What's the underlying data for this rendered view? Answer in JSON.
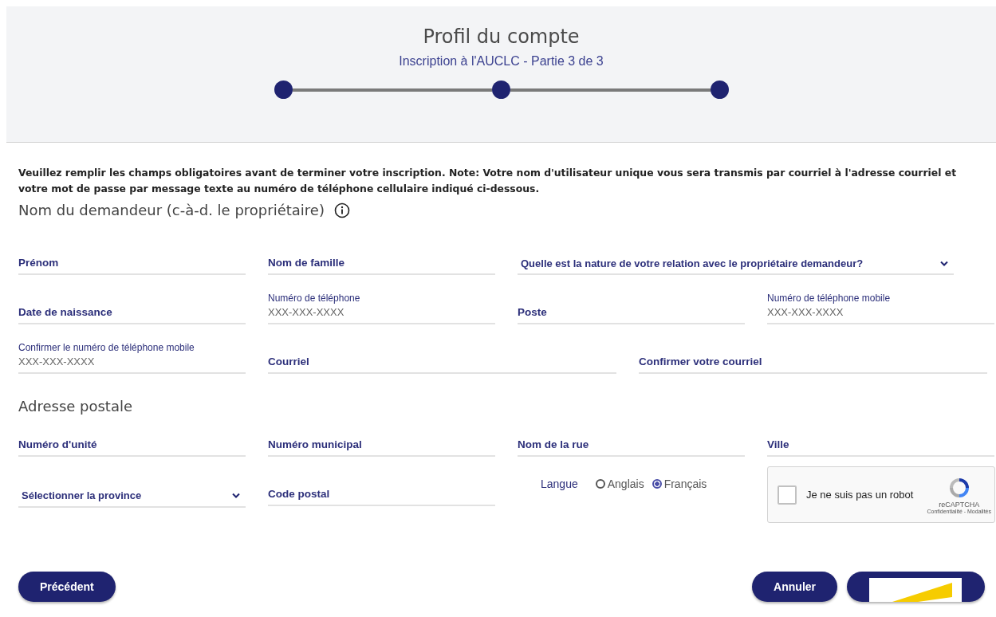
{
  "header": {
    "title": "Profil du compte",
    "subtitle": "Inscription à l'AUCLC - Partie 3 de 3",
    "steps": [
      {
        "completed": true
      },
      {
        "completed": true
      },
      {
        "completed": true
      }
    ]
  },
  "note": "Veuillez remplir les champs obligatoires avant de terminer votre inscription.   Note: Votre nom d'utilisateur unique vous sera transmis par courriel à l'adresse courriel et votre mot de passe par message texte au numéro de téléphone cellulaire indiqué ci-dessous.",
  "sections": [
    {
      "heading": "Nom du demandeur (c-à-d. le propriétaire)",
      "info": true,
      "rows": [
        [
          {
            "kind": "text",
            "label": "Prénom"
          },
          {
            "kind": "text",
            "label": "Nom de famille"
          },
          {
            "kind": "select",
            "label": "Quelle est la nature de votre relation avec le propriétaire demandeur?"
          }
        ],
        [
          {
            "kind": "text",
            "label": "Date de naissance"
          },
          {
            "kind": "text",
            "label": "Numéro de téléphone",
            "placeholder": "XXX-XXX-XXXX"
          },
          {
            "kind": "text",
            "label": "Poste"
          },
          {
            "kind": "text",
            "label": "Numéro de téléphone mobile",
            "placeholder": "XXX-XXX-XXXX"
          }
        ],
        [
          {
            "kind": "text",
            "label": "Confirmer le numéro de téléphone mobile",
            "placeholder": "XXX-XXX-XXXX"
          },
          {
            "kind": "text",
            "label": "Courriel"
          },
          {
            "kind": "text",
            "label": "Confirmer votre courriel"
          }
        ]
      ]
    },
    {
      "heading": "Adresse postale",
      "info": false,
      "rows": [
        [
          {
            "kind": "text",
            "label": "Numéro d'unité"
          },
          {
            "kind": "text",
            "label": "Numéro municipal"
          },
          {
            "kind": "text",
            "label": "Nom de la rue"
          },
          {
            "kind": "text",
            "label": "Ville"
          }
        ],
        [
          {
            "kind": "select",
            "label": "Sélectionner la province"
          },
          {
            "kind": "text",
            "label": "Code postal"
          },
          {
            "kind": "radio",
            "label": "Langue",
            "options": [
              {
                "label": "Anglais",
                "selected": false
              },
              {
                "label": "Français",
                "selected": true
              }
            ]
          },
          {
            "kind": "captcha",
            "label": "Je ne suis pas un robot",
            "checked": false,
            "brand": "reCAPTCHA",
            "links": "Confidentialité - Modalités"
          }
        ]
      ]
    }
  ],
  "footer": {
    "back_button": "Précédent",
    "cancel_button": "Annuler"
  }
}
